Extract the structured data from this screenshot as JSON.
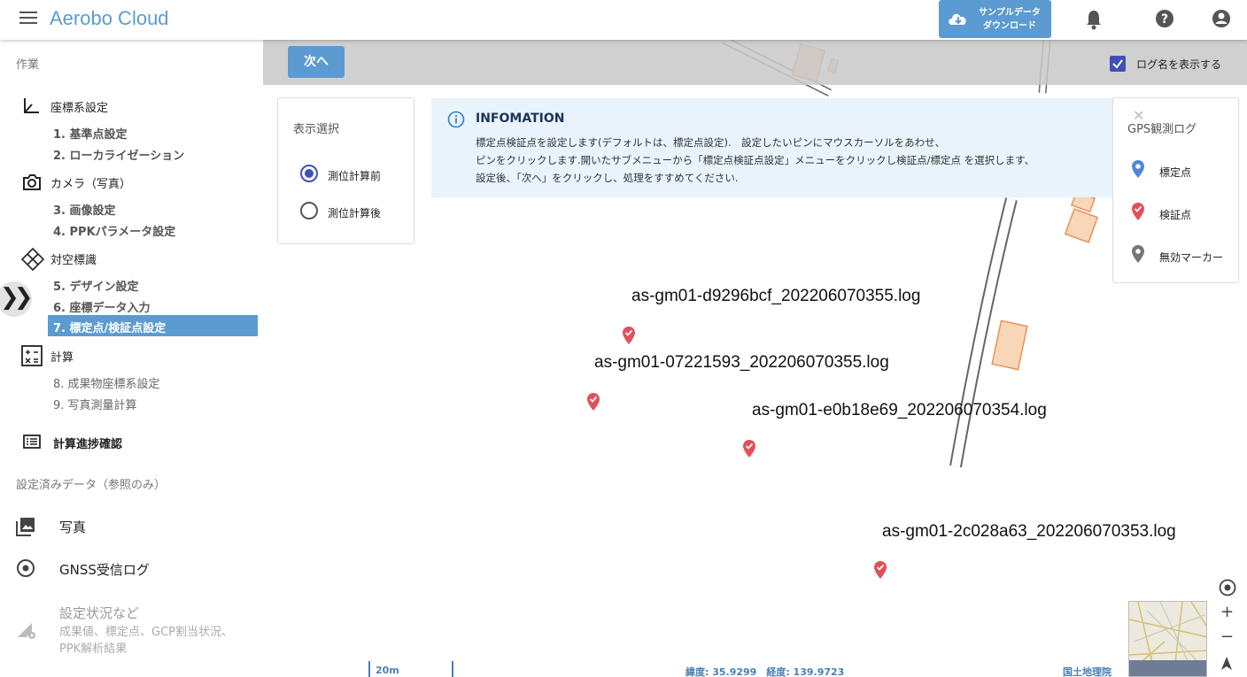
{
  "header": {
    "title": "Aerobo Cloud",
    "download_line1": "サンプルデータ",
    "download_line2": "ダウンロード"
  },
  "sidebar": {
    "section_work": "作業",
    "groups": [
      {
        "label": "座標系設定",
        "icon": "axis-icon"
      },
      {
        "label": "カメラ（写真）",
        "icon": "camera-icon"
      },
      {
        "label": "対空標識",
        "icon": "target-marker-icon"
      },
      {
        "label": "計算",
        "icon": "calculator-icon"
      }
    ],
    "items": [
      "1. 基準点設定",
      "2. ローカライゼーション",
      "3. 画像設定",
      "4. PPKパラメータ設定",
      "5. デザイン設定",
      "6. 座標データ入力",
      "7. 標定点/検証点設定",
      "8. 成果物座標系設定",
      "9. 写真測量計算"
    ],
    "progress_label": "計算進捗確認",
    "section_data": "設定済みデータ（参照のみ）",
    "photos": "写真",
    "gnss_log": "GNSS受信ログ",
    "status_title": "設定状況など",
    "status_sub": "成果値、標定点、GCP割当状況、PPK解析結果"
  },
  "toolbar": {
    "next": "次へ",
    "show_log_names": "ログ名を表示する",
    "show_log_names_checked": true
  },
  "display_select": {
    "title": "表示選択",
    "options": [
      "測位計算前",
      "測位計算後"
    ],
    "selected": "測位計算前"
  },
  "info": {
    "title": "INFOMATION",
    "lines": [
      "標定点検証点を設定します(デフォルトは、標定点設定).　設定したいピンにマウスカーソルをあわせ、",
      "ピンをクリックします.開いたサブメニューから「標定点検証点設定」メニューをクリックし検証点/標定点 を選択します、",
      "設定後、「次へ」をクリックし、処理をすすめてください."
    ]
  },
  "legend": {
    "title": "GPS観測ログ",
    "items": [
      {
        "label": "標定点",
        "color": "#4f86d9"
      },
      {
        "label": "検証点",
        "color": "#e0505a"
      },
      {
        "label": "無効マーカー",
        "color": "#777777"
      }
    ]
  },
  "logs": [
    "as-gm01-d9296bcf_202206070355.log",
    "as-gm01-07221593_202206070355.log",
    "as-gm01-e0b18e69_202206070354.log",
    "as-gm01-2c028a63_202206070353.log"
  ],
  "map": {
    "scale": "20m",
    "coords": "緯度: 35.9299　経度: 139.9723",
    "attribution": "国土地理院"
  }
}
